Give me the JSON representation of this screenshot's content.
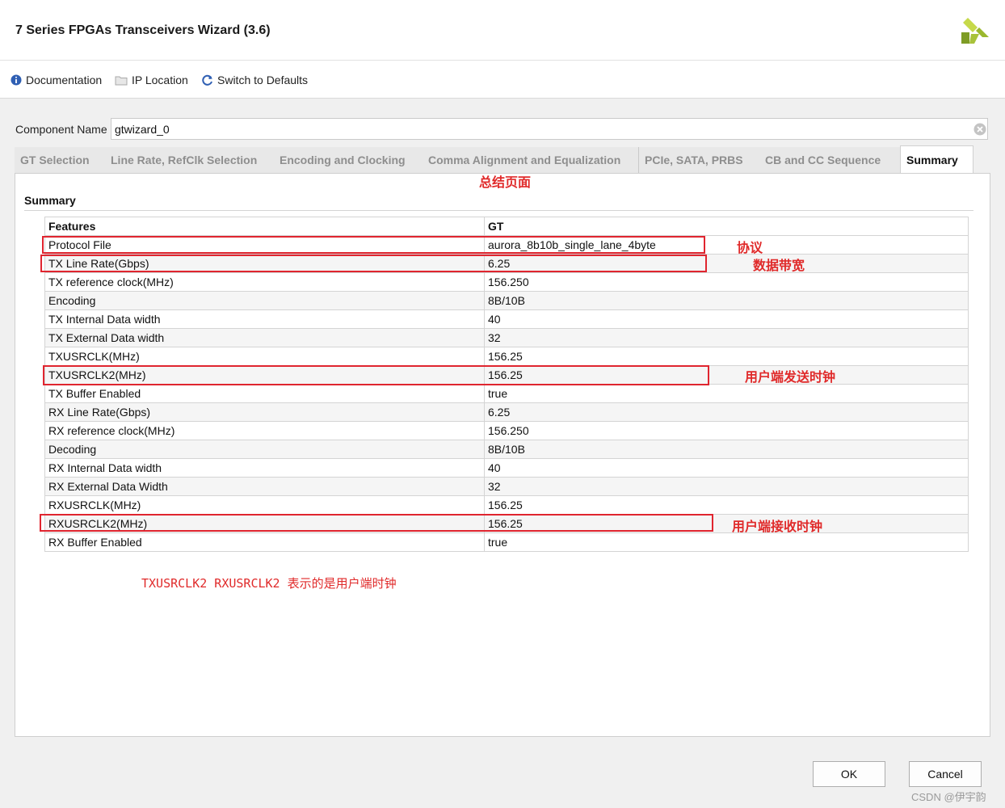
{
  "window": {
    "title": "7 Series FPGAs Transceivers Wizard (3.6)"
  },
  "toolbar": {
    "documentation": "Documentation",
    "ip_location": "IP Location",
    "switch_defaults": "Switch to Defaults"
  },
  "component": {
    "label": "Component Name",
    "value": "gtwizard_0"
  },
  "tabs": [
    {
      "label": "GT Selection"
    },
    {
      "label": "Line Rate, RefClk Selection"
    },
    {
      "label": "Encoding and Clocking"
    },
    {
      "label": "Comma Alignment and Equalization"
    },
    {
      "label": "PCIe, SATA, PRBS"
    },
    {
      "label": "CB and CC Sequence"
    },
    {
      "label": "Summary",
      "active": true
    }
  ],
  "summary": {
    "section_title": "Summary",
    "headers": [
      "Features",
      "GT"
    ],
    "rows": [
      [
        "Protocol File",
        "aurora_8b10b_single_lane_4byte"
      ],
      [
        "TX Line Rate(Gbps)",
        "6.25"
      ],
      [
        "TX reference clock(MHz)",
        "156.250"
      ],
      [
        "Encoding",
        "8B/10B"
      ],
      [
        "TX Internal Data width",
        "40"
      ],
      [
        "TX External Data width",
        "32"
      ],
      [
        "TXUSRCLK(MHz)",
        "156.25"
      ],
      [
        "TXUSRCLK2(MHz)",
        "156.25"
      ],
      [
        "TX Buffer Enabled",
        "true"
      ],
      [
        "RX Line Rate(Gbps)",
        "6.25"
      ],
      [
        "RX reference clock(MHz)",
        "156.250"
      ],
      [
        "Decoding",
        "8B/10B"
      ],
      [
        "RX Internal Data width",
        "40"
      ],
      [
        "RX External Data Width",
        "32"
      ],
      [
        "RXUSRCLK(MHz)",
        "156.25"
      ],
      [
        "RXUSRCLK2(MHz)",
        "156.25"
      ],
      [
        "RX Buffer Enabled",
        "true"
      ]
    ]
  },
  "annotations": {
    "summary_page": "总结页面",
    "protocol": "协议",
    "bandwidth": "数据带宽",
    "user_tx_clock": "用户端发送时钟",
    "user_rx_clock": "用户端接收时钟",
    "note": "TXUSRCLK2  RXUSRCLK2 表示的是用户端时钟",
    "color": "#e0252f"
  },
  "buttons": {
    "ok": "OK",
    "cancel": "Cancel"
  },
  "watermark": "CSDN @伊宇韵"
}
